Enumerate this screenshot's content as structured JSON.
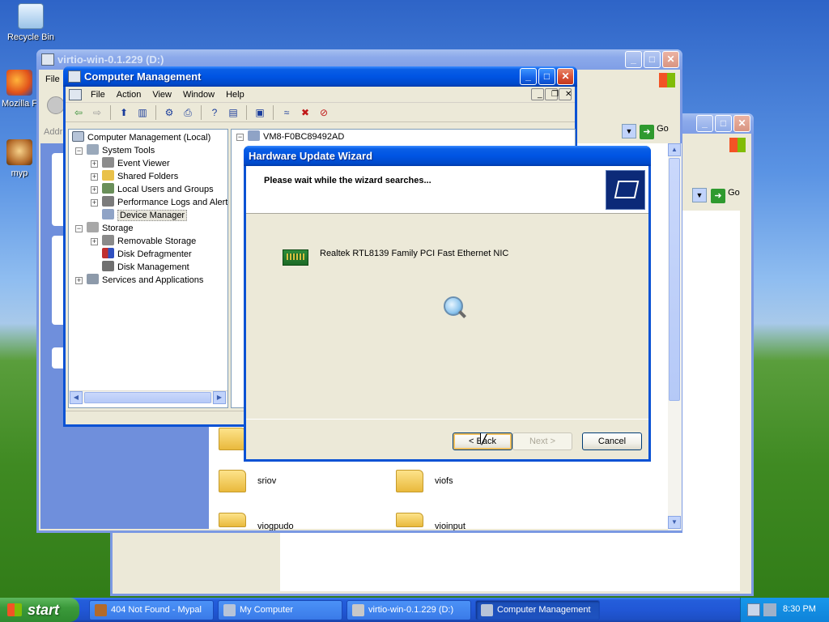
{
  "desktop": {
    "icons": [
      {
        "label": "Recycle Bin"
      },
      {
        "label": "Mozilla F"
      },
      {
        "label": "myp"
      }
    ]
  },
  "explorer_back": {
    "title": "virtio-win-0.1.229 (D:)",
    "menu_file": "File",
    "address_label": "Addr",
    "go_label": "Go",
    "folders": [
      {
        "name": "sriov"
      },
      {
        "name": "viofs"
      },
      {
        "name": "viogpudo"
      },
      {
        "name": "vioinput"
      }
    ]
  },
  "explorer_second": {
    "go_label": "Go"
  },
  "computer_management": {
    "title": "Computer Management",
    "menu": [
      "File",
      "Action",
      "View",
      "Window",
      "Help"
    ],
    "tree": [
      {
        "label": "Computer Management (Local)"
      },
      {
        "label": "System Tools"
      },
      {
        "label": "Event Viewer"
      },
      {
        "label": "Shared Folders"
      },
      {
        "label": "Local Users and Groups"
      },
      {
        "label": "Performance Logs and Alerts"
      },
      {
        "label": "Device Manager"
      },
      {
        "label": "Storage"
      },
      {
        "label": "Removable Storage"
      },
      {
        "label": "Disk Defragmenter"
      },
      {
        "label": "Disk Management"
      },
      {
        "label": "Services and Applications"
      }
    ],
    "right_pane_root": "VM8-F0BC89492AD"
  },
  "wizard": {
    "title": "Hardware Update Wizard",
    "heading": "Please wait while the wizard searches...",
    "device_name": "Realtek RTL8139 Family PCI Fast Ethernet NIC",
    "back_label": "< Back",
    "next_label": "Next >",
    "cancel_label": "Cancel"
  },
  "taskbar": {
    "start_label": "start",
    "tasks": [
      {
        "label": "404 Not Found - Mypal"
      },
      {
        "label": "My Computer"
      },
      {
        "label": "virtio-win-0.1.229 (D:)"
      },
      {
        "label": "Computer Management"
      }
    ],
    "clock": "8:30 PM"
  },
  "colors": {
    "titlebar_active": "#0054e3",
    "titlebar_inactive": "#7f9ee6",
    "taskbar": "#245edb",
    "start_button": "#3b9a3b",
    "window_face": "#ece9d8"
  }
}
